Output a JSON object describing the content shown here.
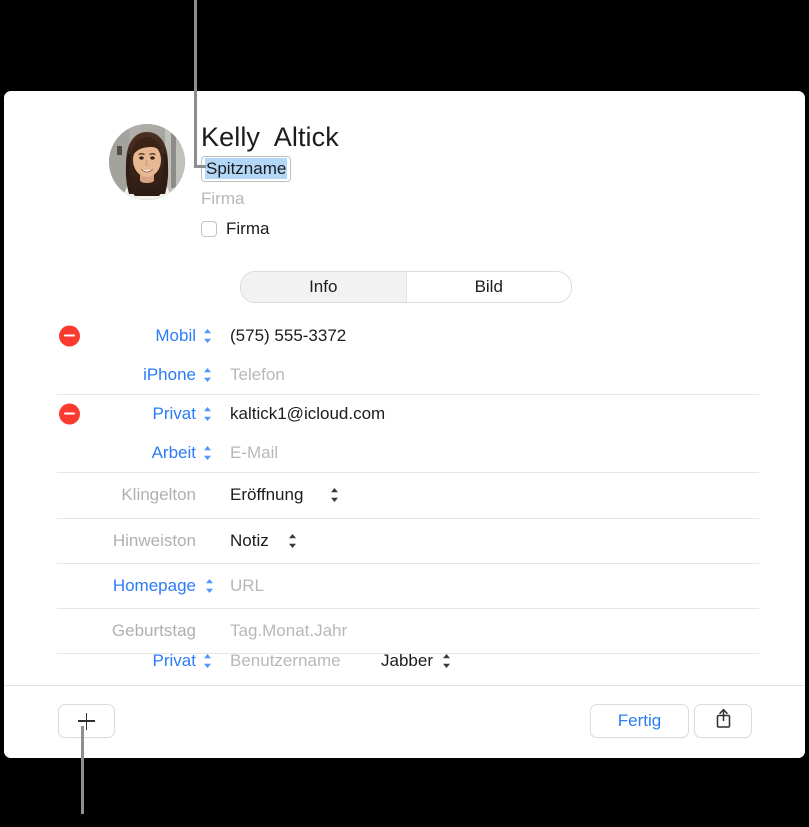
{
  "card": {
    "header": {
      "avatar_name": "contact-photo",
      "full_name": "Kelly  Altick",
      "nickname_value": "Spitzname",
      "company_placeholder": "Firma",
      "company_checkbox_label": "Firma"
    },
    "tabs": [
      {
        "label": "Info",
        "selected": true
      },
      {
        "label": "Bild",
        "selected": false
      }
    ],
    "groups": [
      {
        "name": "phone-group",
        "rows": [
          {
            "has_delete": true,
            "label": "Mobil",
            "label_style": "link",
            "label_has_chevron": true,
            "value": "(575) 555-3372",
            "value_style": "dark",
            "value_has_chevron": false
          },
          {
            "has_delete": false,
            "label": "iPhone",
            "label_style": "link",
            "label_has_chevron": true,
            "value": "Telefon",
            "value_style": "placeholder",
            "value_has_chevron": false
          }
        ]
      },
      {
        "name": "email-group",
        "rows": [
          {
            "has_delete": true,
            "label": "Privat",
            "label_style": "link",
            "label_has_chevron": true,
            "value": "kaltick1@icloud.com",
            "value_style": "dark",
            "value_has_chevron": false
          },
          {
            "has_delete": false,
            "label": "Arbeit",
            "label_style": "link",
            "label_has_chevron": true,
            "value": "E-Mail",
            "value_style": "placeholder",
            "value_has_chevron": false
          }
        ]
      },
      {
        "name": "ringtone-group",
        "rows": [
          {
            "has_delete": false,
            "label": "Klingelton",
            "label_style": "muted",
            "label_has_chevron": false,
            "value": "Eröffnung",
            "value_style": "dark",
            "value_has_chevron": true
          }
        ]
      },
      {
        "name": "texttone-group",
        "rows": [
          {
            "has_delete": false,
            "label": "Hinweiston",
            "label_style": "muted",
            "label_has_chevron": false,
            "value": "Notiz",
            "value_style": "dark",
            "value_has_chevron": true
          }
        ]
      },
      {
        "name": "url-group",
        "rows": [
          {
            "has_delete": false,
            "label": "Homepage",
            "label_style": "link",
            "label_has_chevron": true,
            "value": "URL",
            "value_style": "placeholder",
            "value_has_chevron": false
          }
        ]
      },
      {
        "name": "birthday-group",
        "rows": [
          {
            "has_delete": false,
            "label": "Geburtstag",
            "label_style": "muted",
            "label_has_chevron": false,
            "value": "Tag.Monat.Jahr",
            "value_style": "placeholder",
            "value_has_chevron": false
          }
        ]
      }
    ],
    "clipped_row": {
      "label": "Privat",
      "label_style": "link",
      "value": "Benutzername",
      "value_style": "placeholder",
      "service": "Jabber"
    },
    "toolbar": {
      "add_label": "+",
      "done_label": "Fertig",
      "share_label": "share-icon"
    }
  },
  "colors": {
    "accent_blue": "#2b7cf7",
    "delete_red": "#fc3b30",
    "selection_blue": "#b3d7f7",
    "placeholder_grey": "#b8b8b8",
    "separator": "#e6e6e6",
    "backdrop": "#000000",
    "card": "#ffffff"
  }
}
